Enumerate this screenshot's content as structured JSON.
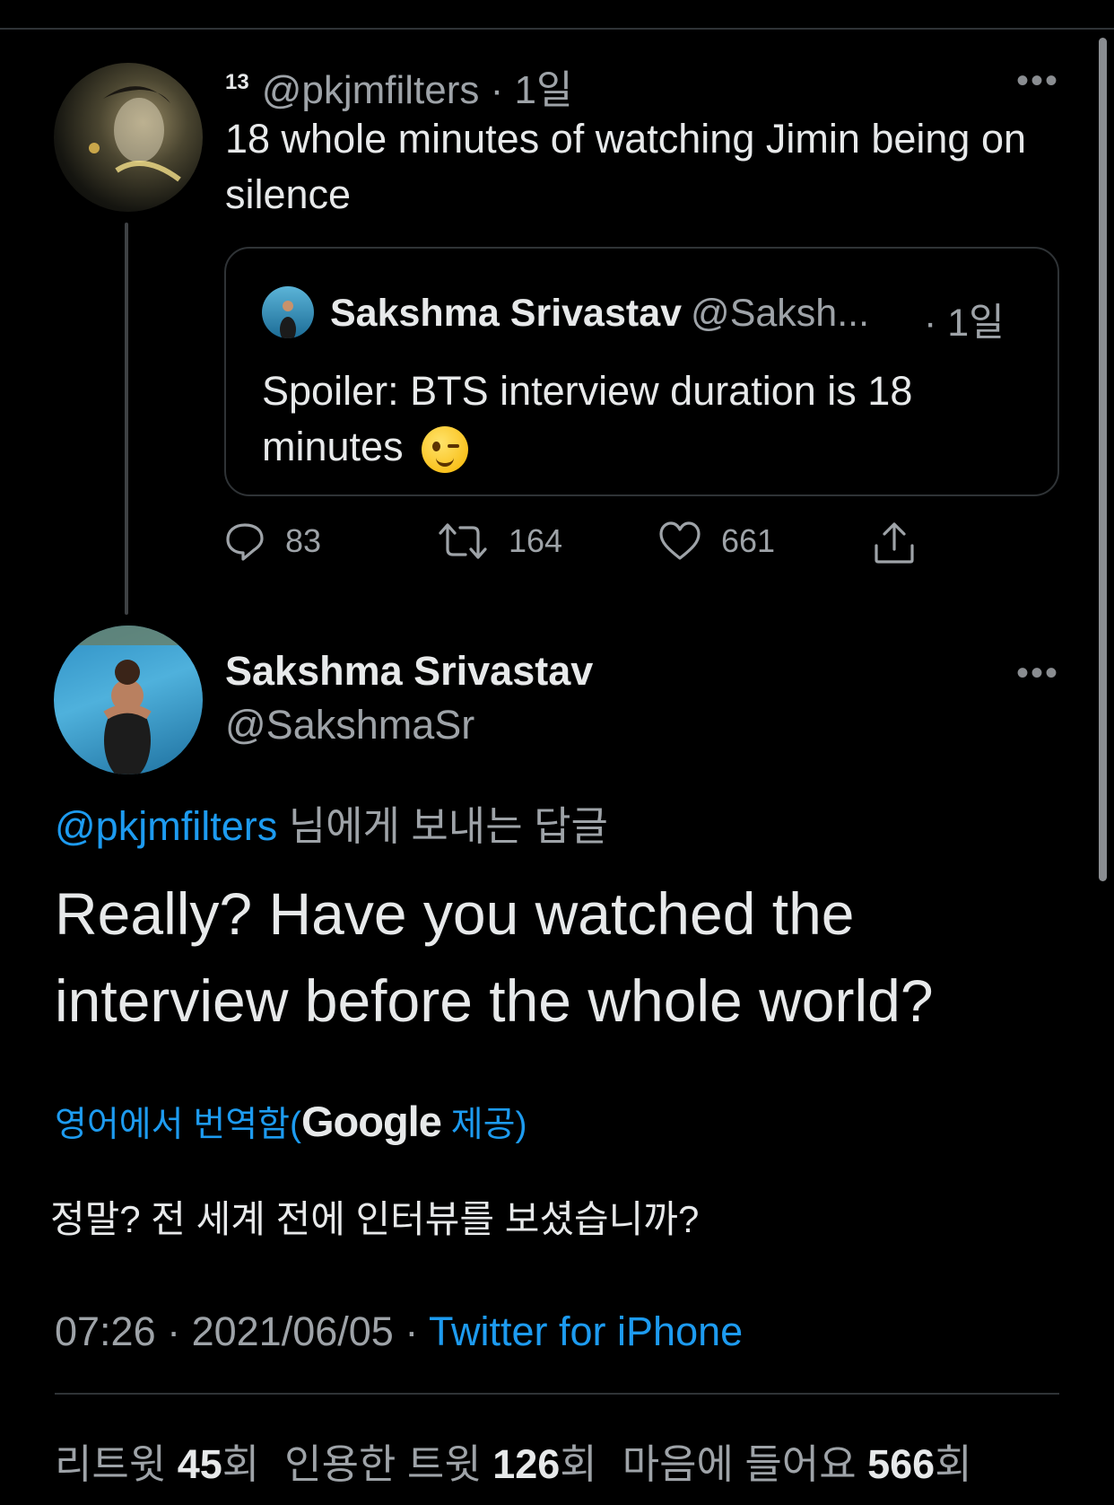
{
  "original_tweet": {
    "badge": "13",
    "handle": "@pkjmfilters",
    "time": "· 1일",
    "text": "18 whole minutes of watching Jimin  being on silence",
    "more_icon": "ellipsis-icon",
    "quoted": {
      "name": "Sakshma Srivastav",
      "handle": "@Saksh...",
      "time": "· 1일",
      "text": "Spoiler: BTS interview duration is 18 minutes",
      "emoji": "winking-face"
    },
    "actions": {
      "replies": "83",
      "retweets": "164",
      "likes": "661"
    }
  },
  "reply_tweet": {
    "name": "Sakshma Srivastav",
    "handle": "@SakshmaSr",
    "reply_to_handle": "@pkjmfilters",
    "reply_to_suffix": " 님에게 보내는 답글",
    "text": "Really? Have you watched the interview before the whole world?",
    "translated_prefix": "영어에서 번역함(",
    "translated_provider": "Google",
    "translated_suffix": " 제공)",
    "translation": "정말? 전 세계 전에 인터뷰를 보셨습니까?",
    "timestamp": "07:26 · 2021/06/05 · ",
    "source": "Twitter for iPhone"
  },
  "stats": {
    "retweets_label": "리트윗 ",
    "retweets_count": "45",
    "retweets_unit": "회",
    "quotes_label": "인용한 트윗 ",
    "quotes_count": "126",
    "quotes_unit": "회",
    "likes_label": "마음에 들어요 ",
    "likes_count": "566",
    "likes_unit": "회"
  },
  "colors": {
    "background": "#000000",
    "link": "#1d9bf0",
    "muted": "#9ea3a8",
    "text": "#e7e9ea"
  }
}
